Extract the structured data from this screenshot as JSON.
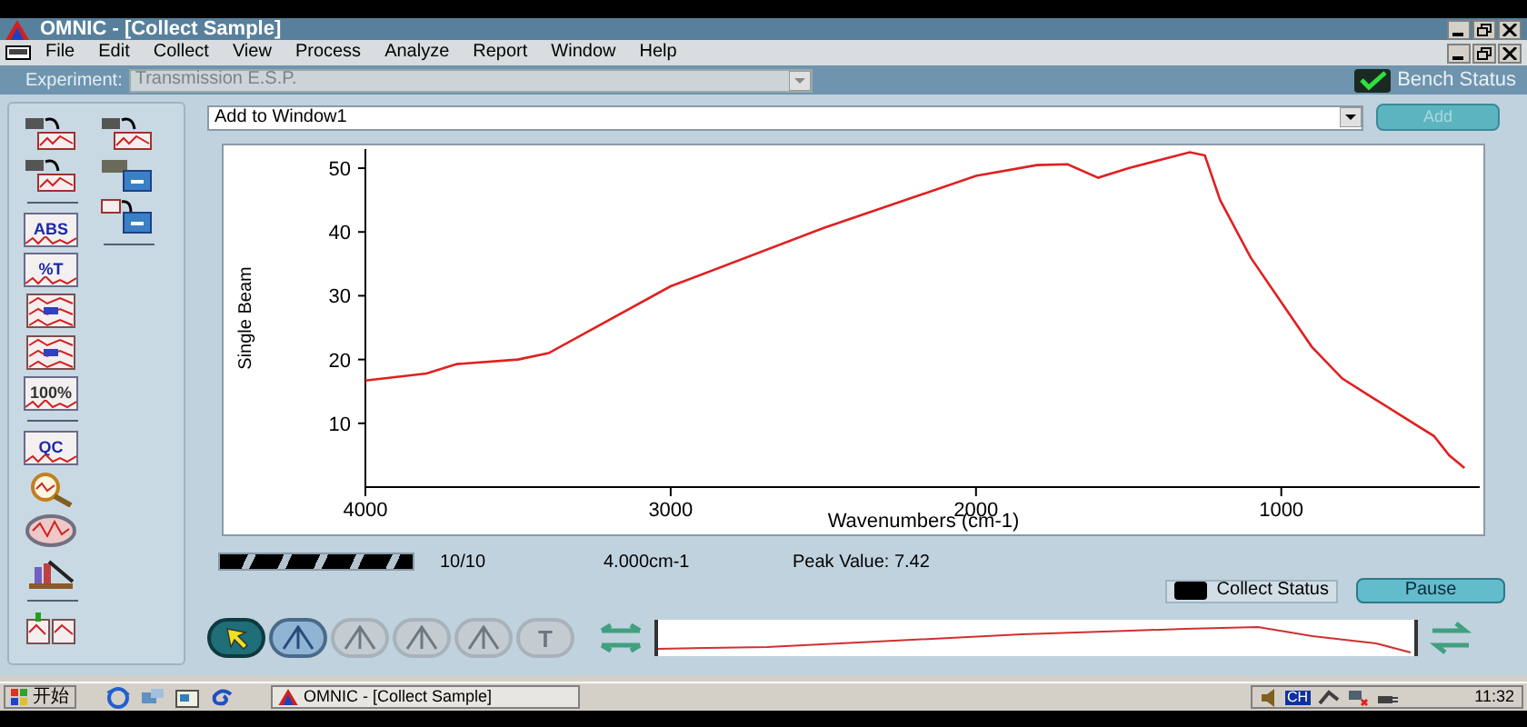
{
  "window": {
    "title": "OMNIC - [Collect Sample]"
  },
  "menu": [
    "File",
    "Edit",
    "Collect",
    "View",
    "Process",
    "Analyze",
    "Report",
    "Window",
    "Help"
  ],
  "experiment": {
    "label": "Experiment:",
    "value": "Transmission E.S.P.",
    "disabled": true
  },
  "bench_status": {
    "label": "Bench Status",
    "checked": true
  },
  "left_toolbar": {
    "columns": [
      {
        "groups": [
          [
            {
              "kind": "collect"
            },
            {
              "kind": "collect"
            }
          ],
          [
            {
              "kind": "labeled",
              "label": "ABS"
            },
            {
              "kind": "labeled",
              "label": "%T"
            },
            {
              "kind": "stack"
            },
            {
              "kind": "stack"
            },
            {
              "kind": "labeled",
              "label": "100%"
            }
          ],
          [
            {
              "kind": "labeled",
              "label": "QC"
            },
            {
              "kind": "magnifier"
            },
            {
              "kind": "oval"
            },
            {
              "kind": "library"
            }
          ],
          [
            {
              "kind": "compare"
            }
          ]
        ]
      },
      {
        "groups": [
          [
            {
              "kind": "collect"
            },
            {
              "kind": "device"
            },
            {
              "kind": "window"
            }
          ]
        ]
      }
    ]
  },
  "window_select": {
    "value": "Add to Window1",
    "button": "Add",
    "button_disabled": true
  },
  "spectrum": {
    "chart_data": {
      "type": "line",
      "xlabel": "Wavenumbers (cm-1)",
      "ylabel": "Single Beam",
      "xlim": [
        4000,
        350
      ],
      "ylim": [
        0,
        53
      ],
      "xticks": [
        4000,
        3000,
        2000,
        1000
      ],
      "yticks": [
        10,
        20,
        30,
        40,
        50
      ],
      "x": [
        4000,
        3800,
        3700,
        3500,
        3400,
        3000,
        2500,
        2200,
        2000,
        1800,
        1700,
        1600,
        1500,
        1300,
        1250,
        1200,
        1100,
        1000,
        900,
        800,
        700,
        600,
        500,
        450,
        400
      ],
      "series": [
        {
          "color": "#e02020",
          "values": [
            16.7,
            17.8,
            19.3,
            20,
            21,
            31.5,
            40.6,
            45.5,
            48.8,
            50.5,
            50.6,
            48.5,
            50,
            52.5,
            52,
            45,
            36,
            29,
            22,
            17,
            14,
            11,
            8,
            5,
            3
          ]
        }
      ]
    }
  },
  "status": {
    "progress": {
      "level": 1
    },
    "scans": "10/10",
    "resolution": "4.000cm-1",
    "peak_value": "Peak Value: 7.42"
  },
  "collect_status": {
    "label": "Collect Status",
    "color": "#000000"
  },
  "pause_button": "Pause",
  "tools": [
    {
      "kind": "arrow",
      "selected": true,
      "disabled": false
    },
    {
      "kind": "peak",
      "selected": false,
      "disabled": false
    },
    {
      "kind": "peak",
      "selected": false,
      "disabled": true
    },
    {
      "kind": "peak",
      "selected": false,
      "disabled": true
    },
    {
      "kind": "peak",
      "selected": false,
      "disabled": true
    },
    {
      "kind": "text",
      "label": "T",
      "selected": false,
      "disabled": true
    }
  ],
  "taskbar": {
    "start": "开始",
    "task": "OMNIC - [Collect Sample]",
    "language": "CH",
    "clock": "11:32"
  }
}
